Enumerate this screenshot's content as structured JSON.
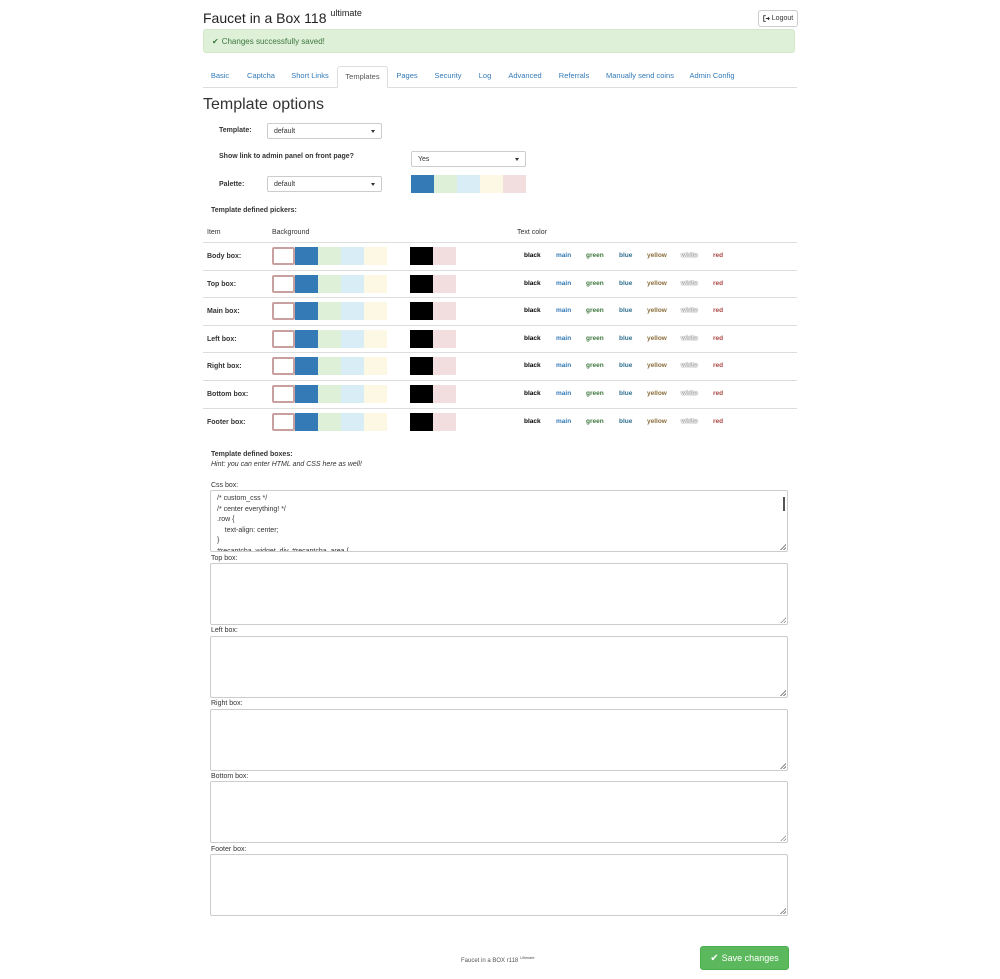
{
  "header": {
    "title": "Faucet in a Box 118",
    "title_sup": "ultimate",
    "logout_label": "Logout"
  },
  "alert": {
    "text": "Changes successfully saved!"
  },
  "tabs": [
    {
      "label": "Basic"
    },
    {
      "label": "Captcha"
    },
    {
      "label": "Short Links"
    },
    {
      "label": "Templates"
    },
    {
      "label": "Pages"
    },
    {
      "label": "Security"
    },
    {
      "label": "Log"
    },
    {
      "label": "Advanced"
    },
    {
      "label": "Referrals"
    },
    {
      "label": "Manually send coins"
    },
    {
      "label": "Admin Config"
    }
  ],
  "page": {
    "title": "Template options",
    "template_label": "Template:",
    "template_value": "default",
    "admin_link_label": "Show link to admin panel on front page?",
    "admin_link_value": "Yes",
    "palette_label": "Palette:",
    "palette_value": "default",
    "pickers_heading": "Template defined pickers:",
    "col_item": "Item",
    "col_background": "Background",
    "col_text_color": "Text color"
  },
  "palette_colors": [
    "#337ab7",
    "#dff0d8",
    "#d9edf7",
    "#fcf8e3",
    "#f2dede"
  ],
  "bg_colors": [
    "#ffffff",
    "#337ab7",
    "#dff0d8",
    "#d9edf7",
    "#fcf8e3"
  ],
  "bg_colors_2": [
    "#000000",
    "#f2dede"
  ],
  "text_colors": [
    {
      "label": "black",
      "color": "#000000"
    },
    {
      "label": "main",
      "color": "#337ab7"
    },
    {
      "label": "green",
      "color": "#3c763d"
    },
    {
      "label": "blue",
      "color": "#31708f"
    },
    {
      "label": "yellow",
      "color": "#8a6d3b"
    },
    {
      "label": "white",
      "color": "#ffffff"
    },
    {
      "label": "red",
      "color": "#a94442"
    }
  ],
  "picker_rows": [
    {
      "label": "Body box:"
    },
    {
      "label": "Top box:"
    },
    {
      "label": "Main box:"
    },
    {
      "label": "Left box:"
    },
    {
      "label": "Right box:"
    },
    {
      "label": "Bottom box:"
    },
    {
      "label": "Footer box:"
    }
  ],
  "boxes": {
    "heading": "Template defined boxes:",
    "hint": "Hint: you can enter HTML and CSS here as well!",
    "css_label": "Css box:",
    "css_value": "/* custom_css */\n/* center everything! */\n.row {\n    text-align: center;\n}\n#recaptcha_widget_div, #recaptcha_area {",
    "top_label": "Top box:",
    "left_label": "Left box:",
    "right_label": "Right box:",
    "bottom_label": "Bottom box:",
    "footer_label": "Footer box:"
  },
  "footer": {
    "text": "Faucet in a BOX r118",
    "sup": "Ultimate"
  },
  "save_label": "Save changes"
}
